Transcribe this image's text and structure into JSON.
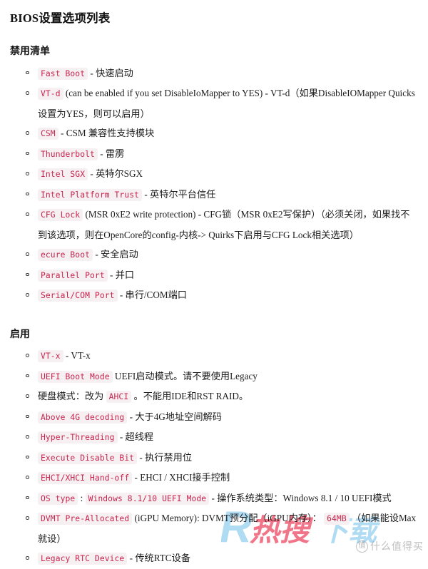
{
  "document": {
    "title": "BIOS设置选项列表"
  },
  "sections": [
    {
      "id": "disable",
      "heading": "禁用清单",
      "items": [
        {
          "parts": [
            {
              "t": "code",
              "v": "Fast Boot"
            },
            {
              "t": "text",
              "v": " - 快速启动"
            }
          ]
        },
        {
          "parts": [
            {
              "t": "code",
              "v": "VT-d"
            },
            {
              "t": "text",
              "v": " (can be enabled if you set DisableIoMapper to YES) - VT-d（如果DisableIOMapper Quicks设置为YES，则可以启用）"
            }
          ]
        },
        {
          "parts": [
            {
              "t": "code",
              "v": "CSM"
            },
            {
              "t": "text",
              "v": " - CSM 兼容性支持模块"
            }
          ]
        },
        {
          "parts": [
            {
              "t": "code",
              "v": "Thunderbolt"
            },
            {
              "t": "text",
              "v": " - 雷雳"
            }
          ]
        },
        {
          "parts": [
            {
              "t": "code",
              "v": "Intel SGX"
            },
            {
              "t": "text",
              "v": " - 英特尔SGX"
            }
          ]
        },
        {
          "parts": [
            {
              "t": "code",
              "v": "Intel Platform Trust"
            },
            {
              "t": "text",
              "v": " - 英特尔平台信任"
            }
          ]
        },
        {
          "parts": [
            {
              "t": "code",
              "v": "CFG Lock"
            },
            {
              "t": "text",
              "v": " (MSR 0xE2 write protection) - CFG锁（MSR 0xE2写保护）（必须关闭，如果找不到该选项，则在OpenCore的config-内核-> Quirks下启用与CFG Lock相关选项）"
            }
          ]
        },
        {
          "parts": [
            {
              "t": "code",
              "v": "ecure Boot"
            },
            {
              "t": "text",
              "v": " - 安全启动"
            }
          ]
        },
        {
          "parts": [
            {
              "t": "code",
              "v": "Parallel Port"
            },
            {
              "t": "text",
              "v": " - 并口"
            }
          ]
        },
        {
          "parts": [
            {
              "t": "code",
              "v": "Serial/COM Port"
            },
            {
              "t": "text",
              "v": " - 串行/COM端口"
            }
          ]
        }
      ]
    },
    {
      "id": "enable",
      "heading": "启用",
      "items": [
        {
          "parts": [
            {
              "t": "code",
              "v": "VT-x"
            },
            {
              "t": "text",
              "v": " - VT-x"
            }
          ]
        },
        {
          "parts": [
            {
              "t": "code",
              "v": "UEFI Boot Mode"
            },
            {
              "t": "text",
              "v": " UEFI启动模式。请不要使用Legacy"
            }
          ]
        },
        {
          "parts": [
            {
              "t": "text",
              "v": "硬盘模式：改为 "
            },
            {
              "t": "code",
              "v": "AHCI"
            },
            {
              "t": "text",
              "v": " 。不能用IDE和RST RAID。"
            }
          ]
        },
        {
          "parts": [
            {
              "t": "code",
              "v": "Above 4G decoding"
            },
            {
              "t": "text",
              "v": " - 大于4G地址空间解码"
            }
          ]
        },
        {
          "parts": [
            {
              "t": "code",
              "v": "Hyper-Threading"
            },
            {
              "t": "text",
              "v": " - 超线程"
            }
          ]
        },
        {
          "parts": [
            {
              "t": "code",
              "v": "Execute Disable Bit"
            },
            {
              "t": "text",
              "v": " - 执行禁用位"
            }
          ]
        },
        {
          "parts": [
            {
              "t": "code",
              "v": "EHCI/XHCI Hand-off"
            },
            {
              "t": "text",
              "v": " - EHCI / XHCI接手控制"
            }
          ]
        },
        {
          "parts": [
            {
              "t": "code",
              "v": "OS type"
            },
            {
              "t": "text",
              "v": " : "
            },
            {
              "t": "code",
              "v": "Windows 8.1/10 UEFI Mode"
            },
            {
              "t": "text",
              "v": " - 操作系统类型：Windows 8.1 / 10 UEFI模式"
            }
          ]
        },
        {
          "parts": [
            {
              "t": "code",
              "v": "DVMT Pre-Allocated"
            },
            {
              "t": "text",
              "v": " (iGPU Memory): DVMT预分配（iGPU内存）： "
            },
            {
              "t": "code",
              "v": "64MB"
            },
            {
              "t": "text",
              "v": " （如果能设Max就设）"
            }
          ]
        },
        {
          "parts": [
            {
              "t": "code",
              "v": "Legacy RTC Device"
            },
            {
              "t": "text",
              "v": " - 传统RTC设备"
            }
          ]
        }
      ]
    }
  ],
  "watermark": {
    "letter": "R",
    "main_text": "热搜下载",
    "badge": "值",
    "sub_text": "什么值得买",
    "color_red": "#f06a7e",
    "color_blue": "#a9d8f2",
    "color_grey": "#8a8a8a"
  }
}
